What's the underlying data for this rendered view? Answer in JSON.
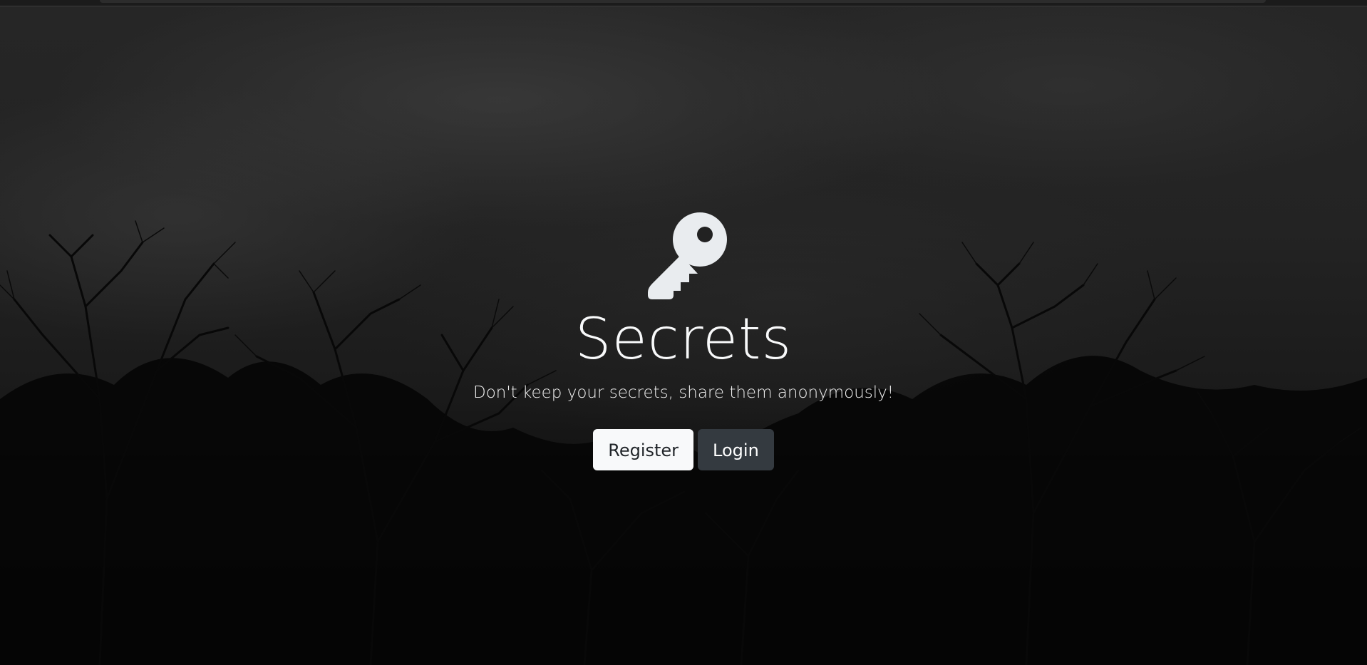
{
  "hero": {
    "icon": "key-icon",
    "title": "Secrets",
    "subtitle": "Don't keep your secrets, share them anonymously!"
  },
  "buttons": {
    "register_label": "Register",
    "login_label": "Login"
  },
  "colors": {
    "title": "#f8f9fa",
    "register_bg": "#f8f9fa",
    "login_bg": "#343a40",
    "icon": "#e9ecef"
  }
}
